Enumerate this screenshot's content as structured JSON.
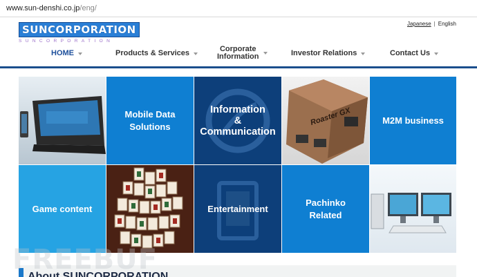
{
  "browser": {
    "url_host": "www.sun-denshi.co.jp",
    "url_path": "/eng/"
  },
  "header": {
    "logo_main": "SUNCORPORATION",
    "logo_sub": "SUNCORPORATION",
    "lang_japanese": "Japanese",
    "lang_separator": "|",
    "lang_english": "English"
  },
  "nav": {
    "items": [
      {
        "label": "HOME"
      },
      {
        "label": "Products & Services"
      },
      {
        "label_line1": "Corporate",
        "label_line2": "Information"
      },
      {
        "label": "Investor Relations"
      },
      {
        "label": "Contact Us"
      }
    ]
  },
  "tiles": {
    "mobile_data_l1": "Mobile Data",
    "mobile_data_l2": "Solutions",
    "info_comm_l1": "Information",
    "info_comm_l2": "&",
    "info_comm_l3": "Communication",
    "router_brand": "Roaster GX",
    "m2m": "M2M business",
    "game_content": "Game content",
    "entertainment": "Entertainment",
    "pachinko_l1": "Pachinko",
    "pachinko_l2": "Related"
  },
  "about": {
    "title": "About SUNCORPORATION"
  },
  "watermark": "FREEBUF",
  "colors": {
    "tile_blue": "#0f7fd2",
    "tile_light_blue": "#26a3e3",
    "tile_navy": "#0d3f7a",
    "nav_rule": "#1a4e8c",
    "home_active": "#1d4f9b"
  }
}
